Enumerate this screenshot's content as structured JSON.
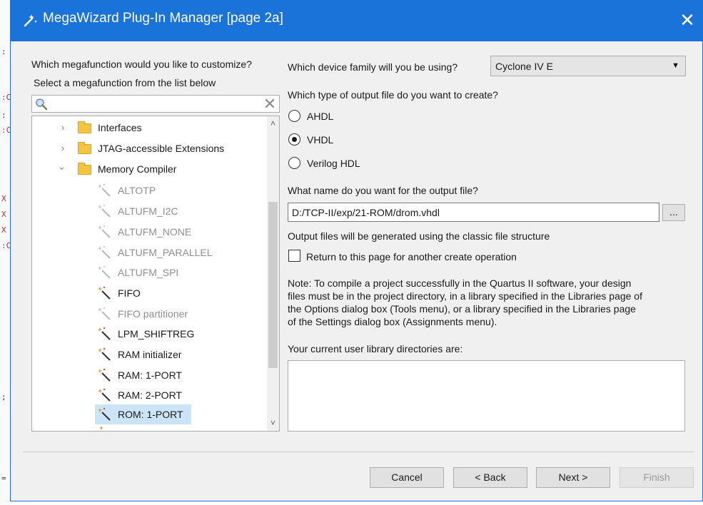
{
  "window": {
    "title": "MegaWizard Plug-In Manager [page 2a]",
    "accent_color": "#1a73d8",
    "title_icon": "wizard-wand-icon"
  },
  "left": {
    "question": "Which megafunction would you like to customize?",
    "instruction": "Select a megafunction from the list below",
    "search": {
      "value": "",
      "placeholder": ""
    },
    "tree": [
      {
        "label": "Interfaces",
        "type": "folder",
        "expanded": false
      },
      {
        "label": "JTAG-accessible Extensions",
        "type": "folder",
        "expanded": false
      },
      {
        "label": "Memory Compiler",
        "type": "folder",
        "expanded": true
      },
      {
        "label": "ALTOTP",
        "type": "leaf",
        "enabled": false
      },
      {
        "label": "ALTUFM_I2C",
        "type": "leaf",
        "enabled": false
      },
      {
        "label": "ALTUFM_NONE",
        "type": "leaf",
        "enabled": false
      },
      {
        "label": "ALTUFM_PARALLEL",
        "type": "leaf",
        "enabled": false
      },
      {
        "label": "ALTUFM_SPI",
        "type": "leaf",
        "enabled": false
      },
      {
        "label": "FIFO",
        "type": "leaf",
        "enabled": true
      },
      {
        "label": "FIFO partitioner",
        "type": "leaf",
        "enabled": false
      },
      {
        "label": "LPM_SHIFTREG",
        "type": "leaf",
        "enabled": true
      },
      {
        "label": "RAM initializer",
        "type": "leaf",
        "enabled": true
      },
      {
        "label": "RAM: 1-PORT",
        "type": "leaf",
        "enabled": true
      },
      {
        "label": "RAM: 2-PORT",
        "type": "leaf",
        "enabled": true
      },
      {
        "label": "ROM: 1-PORT",
        "type": "leaf",
        "enabled": true,
        "selected": true
      }
    ]
  },
  "right": {
    "device_question": "Which device family will you be using?",
    "device_value": "Cyclone IV E",
    "output_type_question": "Which type of output file do you want to create?",
    "output_types": [
      {
        "label": "AHDL",
        "checked": false
      },
      {
        "label": "VHDL",
        "checked": true
      },
      {
        "label": "Verilog HDL",
        "checked": false
      }
    ],
    "filename_question": "What name do you want for the output file?",
    "filename_value": "D:/TCP-II/exp/21-ROM/drom.vhdl",
    "browse_label": "...",
    "structure_note": "Output files will be generated using the classic file structure",
    "return_checkbox_label": "Return to this page for another create operation",
    "return_checked": false,
    "note_lines": [
      "Note: To compile a project successfully in the Quartus II software, your design",
      "files must be in the project directory, in a library specified in the Libraries page of",
      "the Options dialog box (Tools menu), or a library specified in the Libraries page",
      "of the Settings dialog box (Assignments menu)."
    ],
    "library_label": "Your current user library directories are:"
  },
  "buttons": {
    "cancel": "Cancel",
    "back": "< Back",
    "next": "Next >",
    "finish": "Finish"
  }
}
